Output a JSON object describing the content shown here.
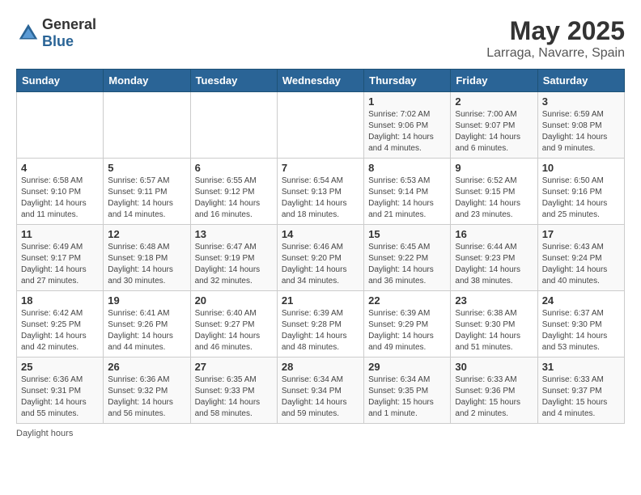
{
  "header": {
    "logo_general": "General",
    "logo_blue": "Blue",
    "month_title": "May 2025",
    "subtitle": "Larraga, Navarre, Spain"
  },
  "days_of_week": [
    "Sunday",
    "Monday",
    "Tuesday",
    "Wednesday",
    "Thursday",
    "Friday",
    "Saturday"
  ],
  "weeks": [
    [
      {
        "day": "",
        "info": ""
      },
      {
        "day": "",
        "info": ""
      },
      {
        "day": "",
        "info": ""
      },
      {
        "day": "",
        "info": ""
      },
      {
        "day": "1",
        "info": "Sunrise: 7:02 AM\nSunset: 9:06 PM\nDaylight: 14 hours\nand 4 minutes."
      },
      {
        "day": "2",
        "info": "Sunrise: 7:00 AM\nSunset: 9:07 PM\nDaylight: 14 hours\nand 6 minutes."
      },
      {
        "day": "3",
        "info": "Sunrise: 6:59 AM\nSunset: 9:08 PM\nDaylight: 14 hours\nand 9 minutes."
      }
    ],
    [
      {
        "day": "4",
        "info": "Sunrise: 6:58 AM\nSunset: 9:10 PM\nDaylight: 14 hours\nand 11 minutes."
      },
      {
        "day": "5",
        "info": "Sunrise: 6:57 AM\nSunset: 9:11 PM\nDaylight: 14 hours\nand 14 minutes."
      },
      {
        "day": "6",
        "info": "Sunrise: 6:55 AM\nSunset: 9:12 PM\nDaylight: 14 hours\nand 16 minutes."
      },
      {
        "day": "7",
        "info": "Sunrise: 6:54 AM\nSunset: 9:13 PM\nDaylight: 14 hours\nand 18 minutes."
      },
      {
        "day": "8",
        "info": "Sunrise: 6:53 AM\nSunset: 9:14 PM\nDaylight: 14 hours\nand 21 minutes."
      },
      {
        "day": "9",
        "info": "Sunrise: 6:52 AM\nSunset: 9:15 PM\nDaylight: 14 hours\nand 23 minutes."
      },
      {
        "day": "10",
        "info": "Sunrise: 6:50 AM\nSunset: 9:16 PM\nDaylight: 14 hours\nand 25 minutes."
      }
    ],
    [
      {
        "day": "11",
        "info": "Sunrise: 6:49 AM\nSunset: 9:17 PM\nDaylight: 14 hours\nand 27 minutes."
      },
      {
        "day": "12",
        "info": "Sunrise: 6:48 AM\nSunset: 9:18 PM\nDaylight: 14 hours\nand 30 minutes."
      },
      {
        "day": "13",
        "info": "Sunrise: 6:47 AM\nSunset: 9:19 PM\nDaylight: 14 hours\nand 32 minutes."
      },
      {
        "day": "14",
        "info": "Sunrise: 6:46 AM\nSunset: 9:20 PM\nDaylight: 14 hours\nand 34 minutes."
      },
      {
        "day": "15",
        "info": "Sunrise: 6:45 AM\nSunset: 9:22 PM\nDaylight: 14 hours\nand 36 minutes."
      },
      {
        "day": "16",
        "info": "Sunrise: 6:44 AM\nSunset: 9:23 PM\nDaylight: 14 hours\nand 38 minutes."
      },
      {
        "day": "17",
        "info": "Sunrise: 6:43 AM\nSunset: 9:24 PM\nDaylight: 14 hours\nand 40 minutes."
      }
    ],
    [
      {
        "day": "18",
        "info": "Sunrise: 6:42 AM\nSunset: 9:25 PM\nDaylight: 14 hours\nand 42 minutes."
      },
      {
        "day": "19",
        "info": "Sunrise: 6:41 AM\nSunset: 9:26 PM\nDaylight: 14 hours\nand 44 minutes."
      },
      {
        "day": "20",
        "info": "Sunrise: 6:40 AM\nSunset: 9:27 PM\nDaylight: 14 hours\nand 46 minutes."
      },
      {
        "day": "21",
        "info": "Sunrise: 6:39 AM\nSunset: 9:28 PM\nDaylight: 14 hours\nand 48 minutes."
      },
      {
        "day": "22",
        "info": "Sunrise: 6:39 AM\nSunset: 9:29 PM\nDaylight: 14 hours\nand 49 minutes."
      },
      {
        "day": "23",
        "info": "Sunrise: 6:38 AM\nSunset: 9:30 PM\nDaylight: 14 hours\nand 51 minutes."
      },
      {
        "day": "24",
        "info": "Sunrise: 6:37 AM\nSunset: 9:30 PM\nDaylight: 14 hours\nand 53 minutes."
      }
    ],
    [
      {
        "day": "25",
        "info": "Sunrise: 6:36 AM\nSunset: 9:31 PM\nDaylight: 14 hours\nand 55 minutes."
      },
      {
        "day": "26",
        "info": "Sunrise: 6:36 AM\nSunset: 9:32 PM\nDaylight: 14 hours\nand 56 minutes."
      },
      {
        "day": "27",
        "info": "Sunrise: 6:35 AM\nSunset: 9:33 PM\nDaylight: 14 hours\nand 58 minutes."
      },
      {
        "day": "28",
        "info": "Sunrise: 6:34 AM\nSunset: 9:34 PM\nDaylight: 14 hours\nand 59 minutes."
      },
      {
        "day": "29",
        "info": "Sunrise: 6:34 AM\nSunset: 9:35 PM\nDaylight: 15 hours\nand 1 minute."
      },
      {
        "day": "30",
        "info": "Sunrise: 6:33 AM\nSunset: 9:36 PM\nDaylight: 15 hours\nand 2 minutes."
      },
      {
        "day": "31",
        "info": "Sunrise: 6:33 AM\nSunset: 9:37 PM\nDaylight: 15 hours\nand 4 minutes."
      }
    ]
  ],
  "footer": {
    "note": "Daylight hours"
  }
}
